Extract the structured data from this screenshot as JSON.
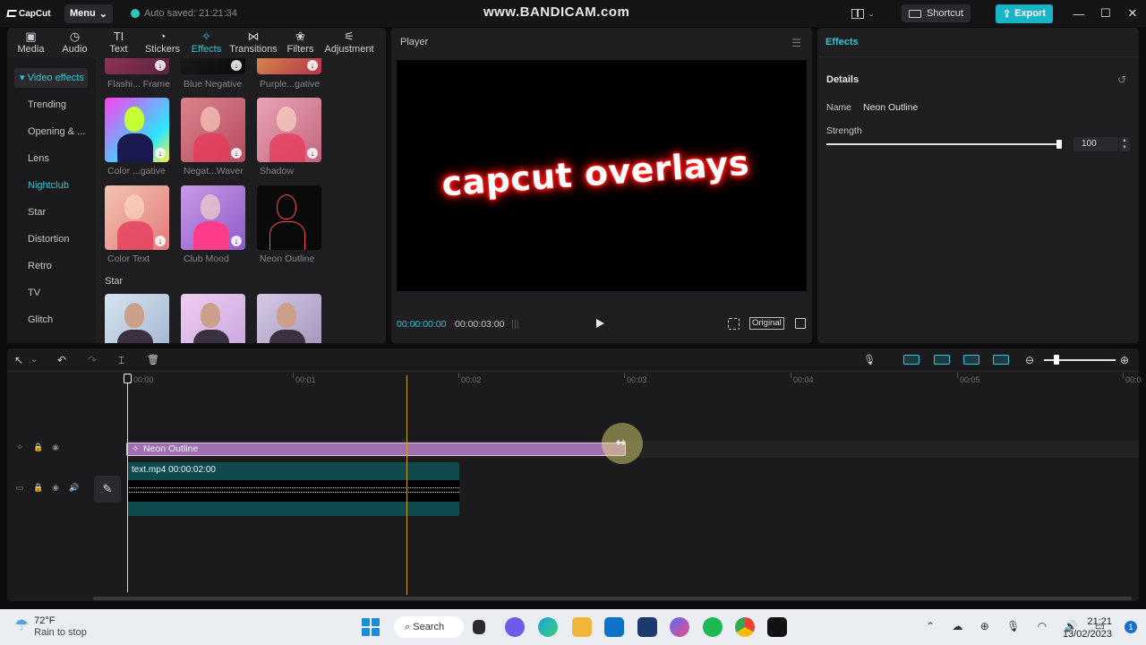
{
  "titlebar": {
    "app_name": "CapCut",
    "menu_label": "Menu",
    "autosave": "Auto saved: 21:21:34",
    "watermark": "www.BANDICAM.com",
    "shortcut_label": "Shortcut",
    "export_label": "Export",
    "minimize": "—",
    "maximize": "☐",
    "close": "✕"
  },
  "media_tabs": [
    {
      "label": "Media",
      "icon": "▣"
    },
    {
      "label": "Audio",
      "icon": "◷"
    },
    {
      "label": "Text",
      "icon": "TI"
    },
    {
      "label": "Stickers",
      "icon": "◔"
    },
    {
      "label": "Effects",
      "icon": "✧"
    },
    {
      "label": "Transitions",
      "icon": "⋈"
    },
    {
      "label": "Filters",
      "icon": "❀"
    },
    {
      "label": "Adjustment",
      "icon": "⚟"
    }
  ],
  "categories": {
    "header": "▾ Video effects",
    "items": [
      "Trending",
      "Opening & ...",
      "Lens",
      "Nightclub",
      "Star",
      "Distortion",
      "Retro",
      "TV",
      "Glitch"
    ]
  },
  "effects_grid": {
    "top_row_labels": [
      "Flashi... Frame",
      "Blue Negative",
      "Purple...gative"
    ],
    "row2_labels": [
      "Color ...gative",
      "Negat...Waver",
      "Shadow"
    ],
    "row3_labels": [
      "Color Text",
      "Club Mood",
      "Neon Outline"
    ],
    "section_star": "Star",
    "download_glyph": "↓"
  },
  "player": {
    "title": "Player",
    "menu_glyph": "☰",
    "overlay_text": "capcut overlays",
    "current_time": "00:00:00:00",
    "total_time": "00:00:03:00",
    "grid_glyph": "|||",
    "original_label": "Original"
  },
  "details": {
    "panel_title": "Effects",
    "section_title": "Details",
    "reset_glyph": "↺",
    "name_label": "Name",
    "name_value": "Neon Outline",
    "strength_label": "Strength",
    "strength_value": "100",
    "strength_fraction": 1.0,
    "spin_up": "▲",
    "spin_down": "▼"
  },
  "timeline": {
    "ruler_labels": [
      "00:00",
      "00:01",
      "00:02",
      "00:03",
      "00:04",
      "00:05",
      "00:0"
    ],
    "effect_clip_label": "Neon Outline",
    "effect_clip_icon": "✧",
    "video_clip_label": "text.mp4  00:00:02:00",
    "edit_glyph": "✎",
    "toolbar": {
      "select_glyph": "↖",
      "dropdown_glyph": "⌄",
      "undo_glyph": "↶",
      "redo_glyph": "↷",
      "split_glyph": "⌶",
      "delete_glyph": "🗑",
      "mic_glyph": "🎙",
      "zoom_out_glyph": "⊖",
      "zoom_in_glyph": "⊕"
    },
    "track_icons": {
      "lock": "🔒",
      "eye": "◉",
      "audio": "🔊",
      "effect": "✧",
      "video": "▭"
    },
    "cursor_glyph": "⇿"
  },
  "taskbar": {
    "temp": "72°F",
    "weather_desc": "Rain to stop",
    "weather_glyph": "☂",
    "search_label": "Search",
    "search_glyph": "⌕",
    "tray_glyphs": "⌃ ☁ ⊕ 🎙 ◠ 🔊 ▭",
    "time": "21:21",
    "date": "13/02/2023",
    "notification_count": "1"
  },
  "colors": {
    "accent": "#2fc6d6",
    "export": "#19b3c6",
    "effect_clip": "#9f6fb2",
    "video_clip": "#0f4a4f",
    "neon": "#ff2a2a"
  }
}
